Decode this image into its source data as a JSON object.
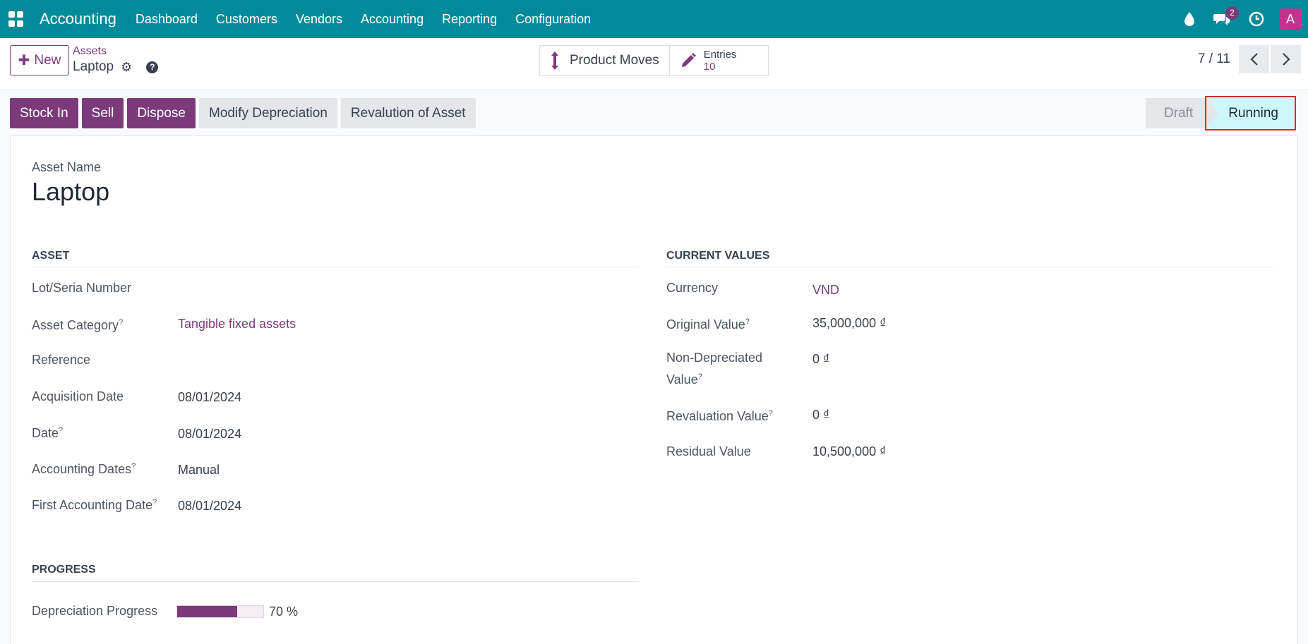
{
  "nav": {
    "app_name": "Accounting",
    "items": [
      "Dashboard",
      "Customers",
      "Vendors",
      "Accounting",
      "Reporting",
      "Configuration"
    ],
    "message_count": "2",
    "avatar_letter": "A",
    "icons": [
      "apps-icon",
      "droplet-icon",
      "chat-icon",
      "clock-icon"
    ]
  },
  "control": {
    "new_label": "New",
    "breadcrumb_parent": "Assets",
    "breadcrumb_current": "Laptop",
    "product_moves_label": "Product Moves",
    "entries_label": "Entries",
    "entries_count": "10",
    "pager": "7 / 11"
  },
  "actions": {
    "buttons": [
      {
        "label": "Stock In",
        "style": "primary"
      },
      {
        "label": "Sell",
        "style": "primary"
      },
      {
        "label": "Dispose",
        "style": "primary"
      },
      {
        "label": "Modify Depreciation",
        "style": "secondary"
      },
      {
        "label": "Revalution of Asset",
        "style": "secondary"
      }
    ],
    "stages": [
      "Draft",
      "Running"
    ],
    "current_stage": "Running"
  },
  "form": {
    "asset_name_label": "Asset Name",
    "asset_name": "Laptop",
    "asset_group": {
      "title": "ASSET",
      "lot_label": "Lot/Seria Number",
      "lot_value": "",
      "category_label": "Asset Category",
      "category_value": "Tangible fixed assets",
      "reference_label": "Reference",
      "reference_value": "",
      "acq_date_label": "Acquisition Date",
      "acq_date_value": "08/01/2024",
      "date_label": "Date",
      "date_value": "08/01/2024",
      "acc_dates_label": "Accounting Dates",
      "acc_dates_value": "Manual",
      "first_acc_date_label": "First Accounting Date",
      "first_acc_date_value": "08/01/2024"
    },
    "values_group": {
      "title": "CURRENT VALUES",
      "currency_label": "Currency",
      "currency_value": "VND",
      "original_label": "Original Value",
      "original_value": "35,000,000 ₫",
      "non_dep_label_1": "Non-Depreciated",
      "non_dep_label_2": "Value",
      "non_dep_value": "0 ₫",
      "reval_label": "Revaluation Value",
      "reval_value": "0 ₫",
      "residual_label": "Residual Value",
      "residual_value": "10,500,000 ₫"
    },
    "progress_group": {
      "title": "PROGRESS",
      "dep_label": "Depreciation Progress",
      "dep_percent": 70,
      "dep_text": "70 %"
    },
    "help_mark": "?"
  },
  "colors": {
    "topbar": "#018b9a",
    "primary": "#7c3a7b",
    "running_stage": "#cdf7fb",
    "highlight": "#d62b2b"
  }
}
